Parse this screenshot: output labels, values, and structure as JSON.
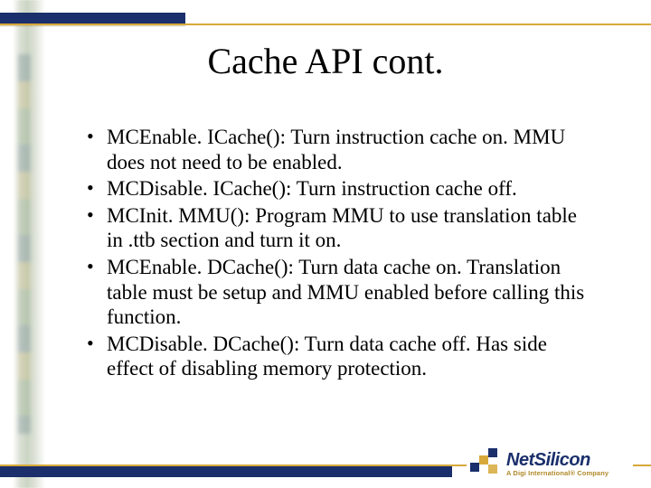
{
  "title": "Cache API cont.",
  "bullets": [
    "MCEnable. ICache():  Turn instruction cache on.  MMU does not need to be enabled.",
    "MCDisable. ICache():  Turn instruction cache off.",
    "MCInit. MMU():  Program MMU to use translation table in .ttb section and turn it on.",
    "MCEnable. DCache():  Turn data cache on.  Translation table must be setup and MMU enabled before calling this function.",
    "MCDisable. DCache():  Turn data cache off.  Has side effect of disabling memory protection."
  ],
  "logo": {
    "brand": "NetSilicon",
    "tagline": "A Digi International® Company"
  }
}
